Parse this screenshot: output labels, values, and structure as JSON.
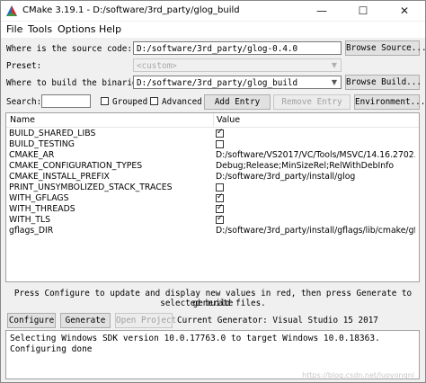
{
  "window": {
    "title": "CMake 3.19.1 - D:/software/3rd_party/glog_build",
    "minimize_icon": "minimize-icon",
    "maximize_icon": "maximize-icon",
    "close_icon": "close-icon"
  },
  "menu": [
    "File",
    "Tools",
    "Options",
    "Help"
  ],
  "source": {
    "label": "Where is the source code:",
    "value": "D:/software/3rd_party/glog-0.4.0",
    "browse": "Browse Source..."
  },
  "preset": {
    "label": "Preset:",
    "value": "<custom>"
  },
  "build": {
    "label": "Where to build the binaries:",
    "value": "D:/software/3rd_party/glog_build",
    "browse": "Browse Build..."
  },
  "search": {
    "label": "Search:",
    "value": "",
    "grouped": "Grouped",
    "grouped_checked": false,
    "advanced": "Advanced",
    "advanced_checked": false,
    "add_entry": "Add Entry",
    "remove_entry": "Remove Entry",
    "environment": "Environment..."
  },
  "table": {
    "headers": [
      "Name",
      "Value"
    ],
    "rows": [
      {
        "name": "BUILD_SHARED_LIBS",
        "type": "bool",
        "checked": true
      },
      {
        "name": "BUILD_TESTING",
        "type": "bool",
        "checked": false
      },
      {
        "name": "CMAKE_AR",
        "type": "text",
        "value": "D:/software/VS2017/VC/Tools/MSVC/14.16.2702..."
      },
      {
        "name": "CMAKE_CONFIGURATION_TYPES",
        "type": "text",
        "value": "Debug;Release;MinSizeRel;RelWithDebInfo"
      },
      {
        "name": "CMAKE_INSTALL_PREFIX",
        "type": "text",
        "value": "D:/software/3rd_party/install/glog"
      },
      {
        "name": "PRINT_UNSYMBOLIZED_STACK_TRACES",
        "type": "bool",
        "checked": false
      },
      {
        "name": "WITH_GFLAGS",
        "type": "bool",
        "checked": true
      },
      {
        "name": "WITH_THREADS",
        "type": "bool",
        "checked": true
      },
      {
        "name": "WITH_TLS",
        "type": "bool",
        "checked": true
      },
      {
        "name": "gflags_DIR",
        "type": "text",
        "value": "D:/software/3rd_party/install/gflags/lib/cmake/gf"
      }
    ]
  },
  "note_line1": "Press Configure to update and display new values in red, then press Generate to generate",
  "note_line2": "selected build files.",
  "actions": {
    "configure": "Configure",
    "generate": "Generate",
    "open_project": "Open Project",
    "generator": "Current Generator: Visual Studio 15 2017"
  },
  "output": [
    "Selecting Windows SDK version 10.0.17763.0 to target Windows 10.0.18363.",
    "Configuring done"
  ],
  "watermark": "https://blog.csdn.net/luoyongni"
}
